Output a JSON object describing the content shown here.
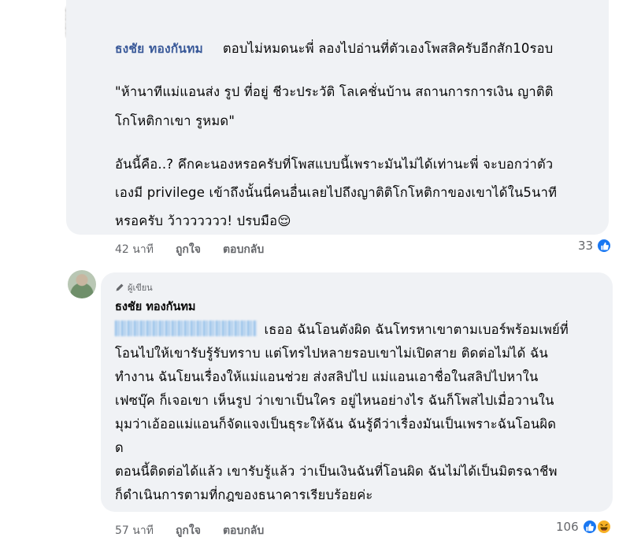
{
  "comment1": {
    "author": "ธงชัย ทองกันทม",
    "lines": [
      "ตอบไม่หมดนะพี่ ลองไปอ่านที่ตัวเองโพสสิครับอีกสัก10รอบ",
      "\"ห้านาทีแม่แอนส่ง รูป ที่อยู่ ชีวะประวัติ  โลเคชั่นบ้าน สถานการการเงิน ญาติติ",
      "โกโหติกาเขา รูหมด\"",
      "อันนี้คือ..? คึกคะนองหรอครับที่โพสแบบนี้เพราะมันไม่ได้เท่านะพี่ จะบอกว่าตัว",
      "เองมี privilege เข้าถึงนั้นนี่คนอื่นเลยไปถึงญาติติโกโหติกาของเขาได้ใน5นาที",
      "หรอครับ ว้าวววววว!  ปรบมือ😌"
    ],
    "time": "42 นาที",
    "like_label": "ถูกใจ",
    "reply_label": "ตอบกลับ",
    "reaction_count": "33"
  },
  "comment2": {
    "badge": "ผู้เขียน",
    "author": "ธงชัย ทองกันทม",
    "lines": [
      "เธออ ฉันโอนตังผิด ฉันโทรหาเขาตามเบอร์พร้อมเพย์ที่",
      "โอนไปให้เขารับรู้รับทราบ แต่โทรไปหลายรอบเขาไม่เปิดสาย ติดต่อไม่ได้ ฉัน",
      "ทำงาน ฉันโยนเรื่องให้แม่แอนช่วย ส่งสลิปไป แม่แอนเอาชื่อในสลิปไปหาใน",
      "เฟซบุ๊ค ก็เจอเขา เห็นรูป ว่าเขาเป็นใคร อยู่ไหนอย่างไร ฉันก็โพสไปเมื่อวานใน",
      "มุมว่าเอ้ออแม่แอนก็จัดแจงเป็นธุระให้ฉัน  ฉันรู้ดีว่าเรื่องมันเป็นเพราะฉันโอนผิด",
      "ด",
      "ตอนนี้ติดต่อได้แล้ว เขารับรู้แล้ว ว่าเป็นเงินฉันที่โอนผิด ฉันไม่ได้เป็นมิตรฉาชีพ",
      "ก็ดำเนินการตามที่กฎของธนาคารเรียบร้อยค่ะ"
    ],
    "time": "57 นาที",
    "like_label": "ถูกใจ",
    "reply_label": "ตอบกลับ",
    "reaction_count": "106"
  },
  "colors": {
    "bubble": "#f0f2f5",
    "author": "#385898",
    "meta": "#65676b",
    "like": "#1877f2",
    "haha": "#f7b125"
  }
}
